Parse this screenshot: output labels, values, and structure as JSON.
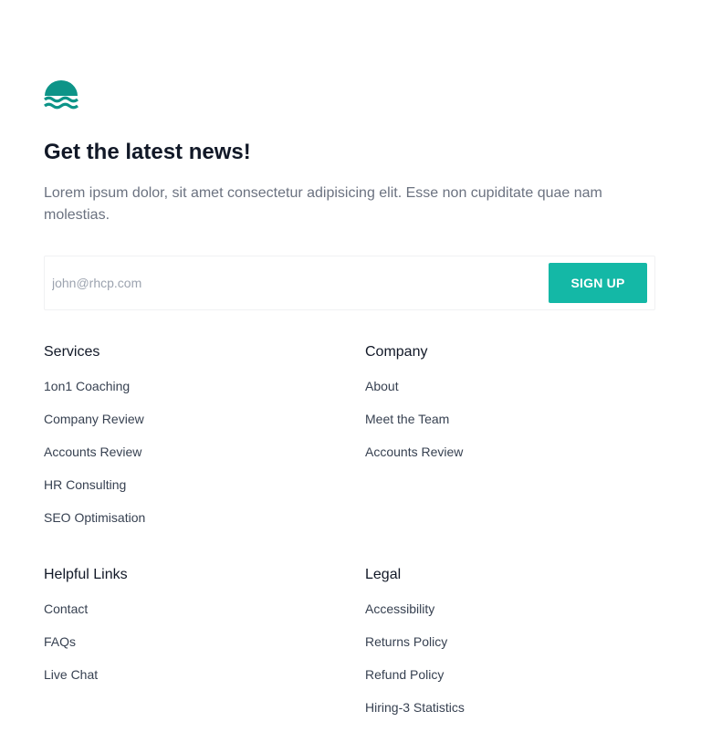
{
  "logo": {
    "icon": "waves-logo-icon",
    "color": "#0d9488"
  },
  "newsletter": {
    "title": "Get the latest news!",
    "description": "Lorem ipsum dolor, sit amet consectetur adipisicing elit. Esse non cupiditate quae nam molestias.",
    "email_placeholder": "john@rhcp.com",
    "signup_label": "SIGN UP",
    "accent_color": "#14b8a6"
  },
  "footer": {
    "services": {
      "heading": "Services",
      "links": [
        "1on1 Coaching",
        "Company Review",
        "Accounts Review",
        "HR Consulting",
        "SEO Optimisation"
      ]
    },
    "company": {
      "heading": "Company",
      "links": [
        "About",
        "Meet the Team",
        "Accounts Review"
      ]
    },
    "helpful_links": {
      "heading": "Helpful Links",
      "links": [
        "Contact",
        "FAQs",
        "Live Chat"
      ]
    },
    "legal": {
      "heading": "Legal",
      "links": [
        "Accessibility",
        "Returns Policy",
        "Refund Policy",
        "Hiring-3 Statistics"
      ]
    }
  }
}
